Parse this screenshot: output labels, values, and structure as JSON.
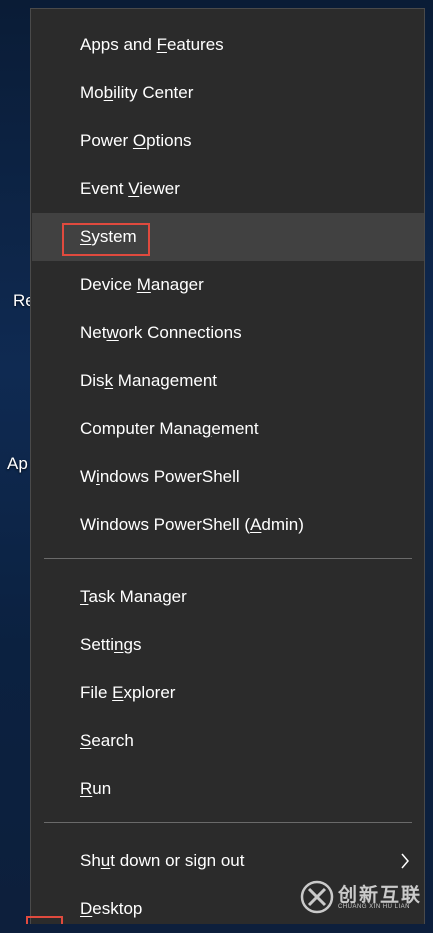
{
  "desktop": {
    "labels": [
      "Re",
      "Ap"
    ]
  },
  "menu": {
    "groups": [
      [
        {
          "id": "apps-and-features",
          "pre": "Apps and ",
          "ul": "F",
          "post": "eatures"
        },
        {
          "id": "mobility-center",
          "pre": "Mo",
          "ul": "b",
          "post": "ility Center"
        },
        {
          "id": "power-options",
          "pre": "Power ",
          "ul": "O",
          "post": "ptions"
        },
        {
          "id": "event-viewer",
          "pre": "Event ",
          "ul": "V",
          "post": "iewer"
        },
        {
          "id": "system",
          "pre": "",
          "ul": "S",
          "post": "ystem",
          "hovered": true,
          "highlighted": true
        },
        {
          "id": "device-manager",
          "pre": "Device ",
          "ul": "M",
          "post": "anager"
        },
        {
          "id": "network-connections",
          "pre": "Net",
          "ul": "w",
          "post": "ork Connections"
        },
        {
          "id": "disk-management",
          "pre": "Dis",
          "ul": "k",
          "post": " Management"
        },
        {
          "id": "computer-management",
          "pre": "Computer Mana",
          "ul": "g",
          "post": "ement"
        },
        {
          "id": "windows-powershell",
          "pre": "W",
          "ul": "i",
          "post": "ndows PowerShell"
        },
        {
          "id": "windows-powershell-admin",
          "pre": "Windows PowerShell (",
          "ul": "A",
          "post": "dmin)"
        }
      ],
      [
        {
          "id": "task-manager",
          "pre": "",
          "ul": "T",
          "post": "ask Manager"
        },
        {
          "id": "settings",
          "pre": "Setti",
          "ul": "n",
          "post": "gs"
        },
        {
          "id": "file-explorer",
          "pre": "File ",
          "ul": "E",
          "post": "xplorer"
        },
        {
          "id": "search",
          "pre": "",
          "ul": "S",
          "post": "earch"
        },
        {
          "id": "run",
          "pre": "",
          "ul": "R",
          "post": "un"
        }
      ],
      [
        {
          "id": "shut-down-or-sign-out",
          "pre": "Sh",
          "ul": "u",
          "post": "t down or sign out",
          "submenu": true
        },
        {
          "id": "desktop",
          "pre": "",
          "ul": "D",
          "post": "esktop"
        }
      ]
    ]
  },
  "watermark": {
    "text": "创新互联",
    "subtext": "CHUANG XIN HU LIAN"
  },
  "colors": {
    "menu_bg": "#2b2b2b",
    "hover_bg": "#414141",
    "highlight": "#e04a3e",
    "text": "#ffffff"
  },
  "icons": {
    "submenu": "chevron-right-icon",
    "watermark_logo": "logo-icon"
  }
}
